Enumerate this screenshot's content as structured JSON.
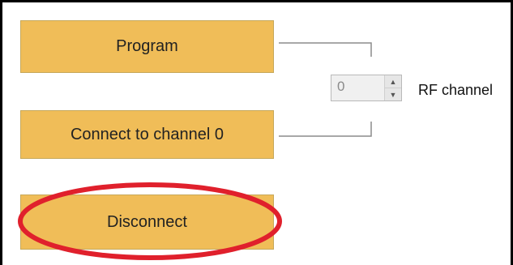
{
  "colors": {
    "button_fill": "#f0bd58",
    "highlight_ellipse": "#e0202c",
    "connector_line": "#8c8c8c"
  },
  "buttons": {
    "program": "Program",
    "connect": "Connect to channel 0",
    "disconnect": "Disconnect"
  },
  "rf_channel": {
    "value": "0",
    "label": "RF channel"
  }
}
